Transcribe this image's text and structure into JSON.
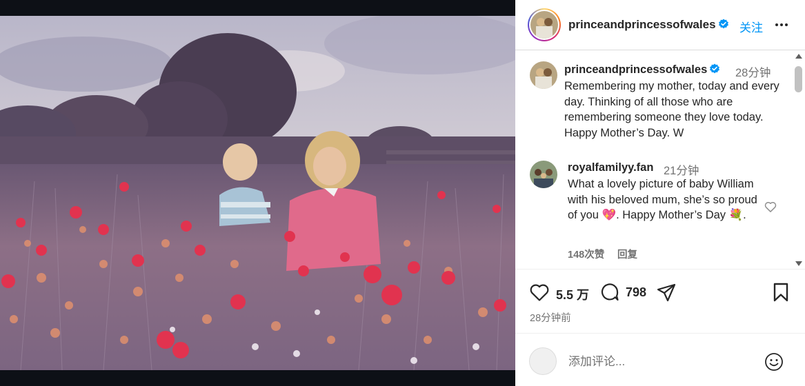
{
  "post": {
    "username": "princeandprincessofwales",
    "follow_label": "关注",
    "caption_time": "28分钟",
    "caption": "Remembering my mother, today and every day. Thinking of all those who are remembering someone they love today. Happy Mother’s Day. W"
  },
  "comments": [
    {
      "username": "royalfamilyy.fan",
      "time": "21分钟",
      "text": "What a lovely picture of baby William with his beloved mum, she’s so proud of you 💖. Happy Mother’s Day 💐.",
      "likes": "148次赞",
      "reply_label": "回复"
    }
  ],
  "actions": {
    "likes": "5.5 万",
    "comments": "798",
    "posted": "28分钟前"
  },
  "add_comment": {
    "placeholder": "添加评论..."
  },
  "icons": {
    "verified": "verified-badge-icon",
    "more": "more-options-icon",
    "like": "heart-icon",
    "comment": "comment-bubble-icon",
    "share": "paper-plane-icon",
    "save": "bookmark-icon",
    "emoji": "emoji-icon"
  },
  "colors": {
    "accent": "#0095f6",
    "verified": "#0095f6",
    "muted_text": "#737373"
  }
}
